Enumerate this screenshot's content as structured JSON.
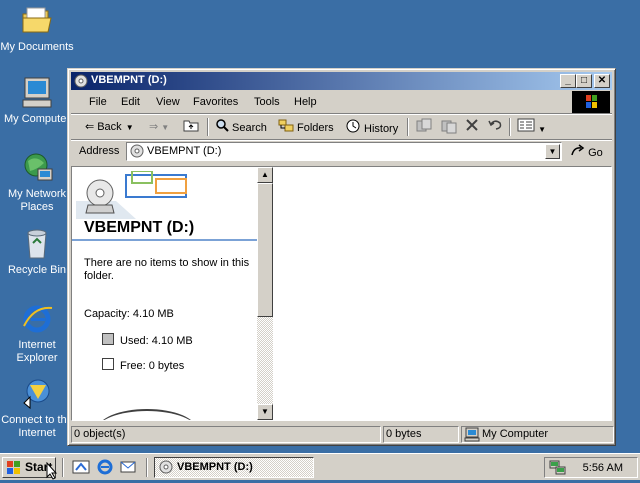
{
  "desktop": {
    "icons": [
      {
        "label": "My Documents"
      },
      {
        "label": "My Computer"
      },
      {
        "label": "My Network Places"
      },
      {
        "label": "Recycle Bin"
      },
      {
        "label": "Internet Explorer"
      },
      {
        "label": "Connect to the Internet"
      }
    ],
    "background_color": "#3a6ea5"
  },
  "window": {
    "title": "VBEMPNT (D:)",
    "caption_buttons": {
      "minimize": "_",
      "maximize": "□",
      "close": "✕"
    },
    "menu": [
      "File",
      "Edit",
      "View",
      "Favorites",
      "Tools",
      "Help"
    ],
    "toolbar": {
      "back": "Back",
      "search": "Search",
      "folders": "Folders",
      "history": "History"
    },
    "address": {
      "label": "Address",
      "value": "VBEMPNT (D:)",
      "go": "Go"
    },
    "webview": {
      "drive_title": "VBEMPNT (D:)",
      "empty_message": "There are no items to show in this folder.",
      "capacity": "Capacity: 4.10 MB",
      "used": "Used: 4.10 MB",
      "free": "Free: 0 bytes"
    },
    "status": {
      "objects": "0 object(s)",
      "size": "0 bytes",
      "zone": "My Computer"
    }
  },
  "taskbar": {
    "start": "Start",
    "active_task": "VBEMPNT (D:)",
    "clock": "5:56 AM"
  },
  "colors": {
    "title_gradient_start": "#0a246a",
    "title_gradient_end": "#a6caf0",
    "face": "#d4d0c8"
  }
}
